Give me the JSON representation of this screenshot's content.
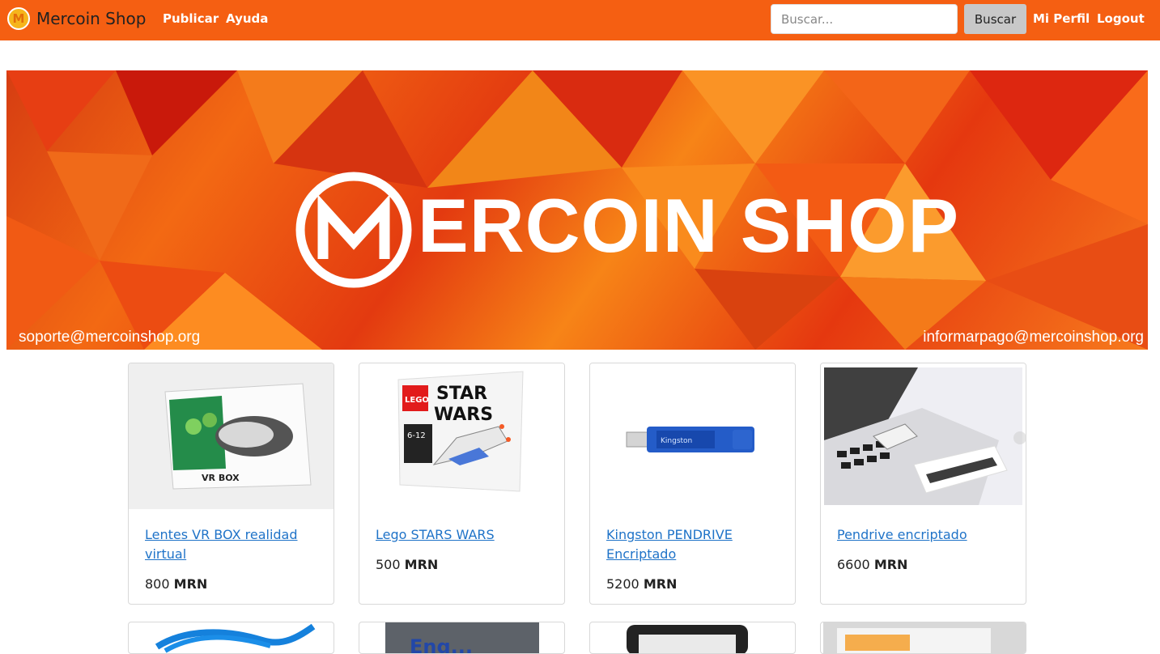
{
  "navbar": {
    "brand": "Mercoin Shop",
    "links": [
      "Publicar",
      "Ayuda"
    ],
    "search_placeholder": "Buscar...",
    "search_button": "Buscar",
    "profile": "Mi Perfil",
    "logout": "Logout",
    "accent_color": "#f55f12"
  },
  "banner": {
    "title": "ERCOIN SHOP",
    "support_email": "soporte@mercoinshop.org",
    "payment_email": "informarpago@mercoinshop.org"
  },
  "products": [
    {
      "title": "Lentes VR BOX realidad virtual",
      "price": "800",
      "currency": "MRN",
      "image": "vr-box-image"
    },
    {
      "title": "Lego STARS WARS",
      "price": "500",
      "currency": "MRN",
      "image": "lego-star-wars-image"
    },
    {
      "title": "Kingston PENDRIVE Encriptado",
      "price": "5200",
      "currency": "MRN",
      "image": "kingston-pendrive-image"
    },
    {
      "title": "Pendrive encriptado",
      "price": "6600",
      "currency": "MRN",
      "image": "encrypted-pendrive-image"
    }
  ]
}
